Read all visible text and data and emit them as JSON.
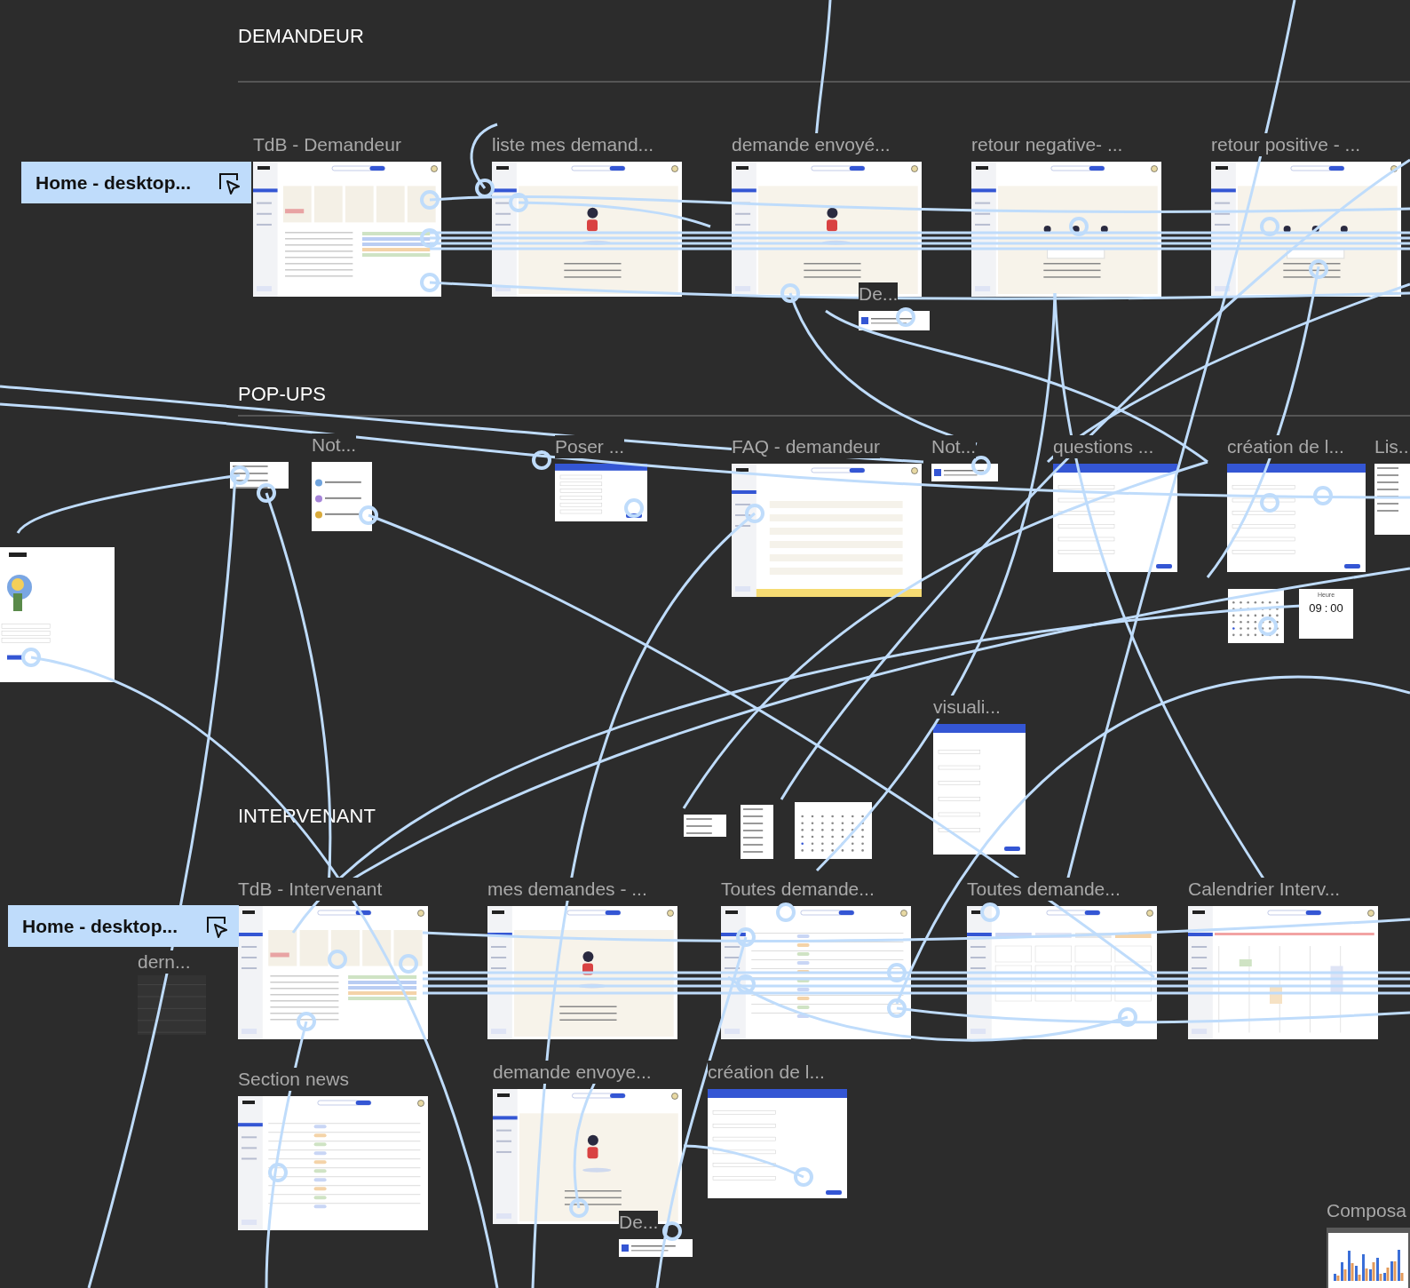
{
  "sections": [
    {
      "label": "DEMANDEUR"
    },
    {
      "label": "POP-UPS"
    },
    {
      "label": "INTERVENANT"
    }
  ],
  "flow_starts": [
    {
      "label": "Home - desktop..."
    },
    {
      "label": "Home - desktop..."
    }
  ],
  "frames": [
    {
      "title": "TdB - Demandeur",
      "kind": "dashboard"
    },
    {
      "title": "liste mes demand...",
      "kind": "empty"
    },
    {
      "title": "demande envoyé...",
      "kind": "empty"
    },
    {
      "title": "retour negative- ...",
      "kind": "feedback"
    },
    {
      "title": "retour positive - ...",
      "kind": "feedback"
    },
    {
      "title": "De...",
      "kind": "toast"
    },
    {
      "kind": "menu"
    },
    {
      "title": "Not...",
      "kind": "notifications"
    },
    {
      "title": "Poser ...",
      "kind": "modal"
    },
    {
      "title": "FAQ - demandeur",
      "kind": "faq"
    },
    {
      "title": "Not...",
      "kind": "toast"
    },
    {
      "title": "questions ...",
      "kind": "modal"
    },
    {
      "title": "création de l...",
      "kind": "modal"
    },
    {
      "title": "Lis...",
      "kind": "menu"
    },
    {
      "kind": "calendar"
    },
    {
      "title": "visuali...",
      "kind": "modal"
    },
    {
      "kind": "login"
    },
    {
      "kind": "menu"
    },
    {
      "kind": "menu"
    },
    {
      "kind": "calendar"
    },
    {
      "title": "TdB - Intervenant",
      "kind": "dashboard"
    },
    {
      "title": "mes demandes - ...",
      "kind": "empty"
    },
    {
      "title": "Toutes demande...",
      "kind": "table"
    },
    {
      "title": "Toutes demande...",
      "kind": "kanban"
    },
    {
      "title": "Calendrier Interv...",
      "kind": "agenda"
    },
    {
      "title": "dern...",
      "kind": "faded"
    },
    {
      "title": "Section news",
      "kind": "table"
    },
    {
      "title": "demande envoye...",
      "kind": "empty"
    },
    {
      "title": "création de l...",
      "kind": "modal"
    },
    {
      "title": "De...",
      "kind": "toast"
    },
    {
      "title": "Composa",
      "kind": "chart"
    }
  ],
  "time_picker": {
    "title": "Heure",
    "hours": "09",
    "separator": ":",
    "minutes": "00"
  }
}
